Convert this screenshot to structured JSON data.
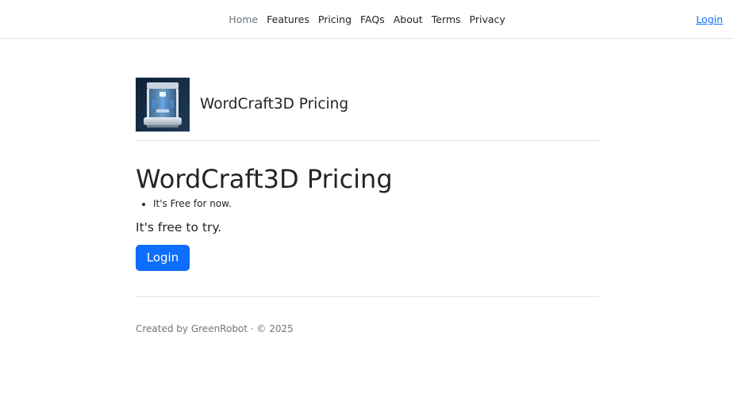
{
  "nav": {
    "items": [
      {
        "label": "Home",
        "active": true
      },
      {
        "label": "Features",
        "active": false
      },
      {
        "label": "Pricing",
        "active": false
      },
      {
        "label": "FAQs",
        "active": false
      },
      {
        "label": "About",
        "active": false
      },
      {
        "label": "Terms",
        "active": false
      },
      {
        "label": "Privacy",
        "active": false
      }
    ],
    "login_label": "Login"
  },
  "brand": {
    "logo_icon": "3d-printer-icon",
    "title": "WordCraft3D Pricing"
  },
  "main": {
    "heading": "WordCraft3D Pricing",
    "features": [
      "It's Free for now."
    ],
    "lead": "It's free to try.",
    "login_button_label": "Login"
  },
  "footer": {
    "text": "Created by GreenRobot · © 2025"
  },
  "colors": {
    "primary": "#0d6efd",
    "text": "#212529",
    "muted": "#6c757d",
    "border": "#dee2e6"
  }
}
